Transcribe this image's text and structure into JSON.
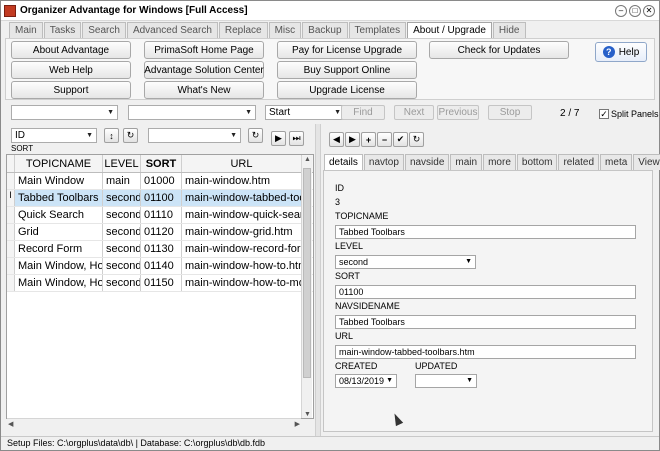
{
  "window": {
    "title": "Organizer Advantage for Windows [Full Access]",
    "controls": [
      "–",
      "□",
      "✕"
    ]
  },
  "tabs": [
    "Main",
    "Tasks",
    "Search",
    "Advanced Search",
    "Replace",
    "Misc",
    "Backup",
    "Templates",
    "About / Upgrade",
    "Hide"
  ],
  "active_tab": "About / Upgrade",
  "toolbar": {
    "buttons": [
      "About Advantage",
      "PrimaSoft Home Page",
      "Pay for License Upgrade",
      "Check for Updates",
      "Web Help",
      "Advantage Solution Center",
      "Buy Support Online",
      "Support",
      "What's New",
      "Upgrade License"
    ],
    "help_label": "Help",
    "help_icon": "?"
  },
  "search": {
    "field1": "",
    "field2": "",
    "mode": "Start",
    "find": "Find",
    "next": "Next",
    "previous": "Previous",
    "stop": "Stop",
    "record_position": "2 / 7",
    "split_panels_label": "Split Panels",
    "split_panels_checked": true,
    "check_glyph": "✓"
  },
  "list_controls": {
    "sort_field": "ID",
    "sort_caption": "SORT",
    "filter_value": "",
    "nav_glyphs": [
      "↕",
      "↻",
      "▶",
      "⏭"
    ]
  },
  "grid": {
    "columns": [
      "TOPICNAME",
      "LEVEL",
      "SORT",
      "URL"
    ],
    "rows": [
      [
        "Main Window",
        "main",
        "01000",
        "main-window.htm"
      ],
      [
        "Tabbed Toolbars",
        "second",
        "01100",
        "main-window-tabbed-toolbars.htm"
      ],
      [
        "Quick Search",
        "second",
        "01110",
        "main-window-quick-search.htm"
      ],
      [
        "Grid",
        "second",
        "01120",
        "main-window-grid.htm"
      ],
      [
        "Record Form",
        "second",
        "01130",
        "main-window-record-form.htm"
      ],
      [
        "Main Window, How To",
        "second",
        "01140",
        "main-window-how-to.htm"
      ],
      [
        "Main Window, How To",
        "second",
        "01150",
        "main-window-how-to-more.htm"
      ]
    ],
    "selected_row": 1,
    "current_row_marker": "I"
  },
  "record_nav": {
    "glyphs": [
      "◀",
      "▶",
      "+",
      "−",
      "✔",
      "↻"
    ]
  },
  "detail_tabs": [
    "details",
    "navtop",
    "navside",
    "main",
    "more",
    "bottom",
    "related",
    "meta",
    "View"
  ],
  "active_detail_tab": "details",
  "record": {
    "id_label": "ID",
    "id_value": "3",
    "topicname_label": "TOPICNAME",
    "topicname_value": "Tabbed Toolbars",
    "level_label": "LEVEL",
    "level_value": "second",
    "sort_label": "SORT",
    "sort_value": "01100",
    "navsidename_label": "NAVSIDENAME",
    "navsidename_value": "Tabbed Toolbars",
    "url_label": "URL",
    "url_value": "main-window-tabbed-toolbars.htm",
    "created_label": "CREATED",
    "created_value": "08/13/2019",
    "updated_label": "UPDATED",
    "updated_value": ""
  },
  "statusbar": {
    "text": "Setup Files: C:\\orgplus\\data\\db\\ | Database: C:\\orgplus\\db\\db.fdb"
  }
}
